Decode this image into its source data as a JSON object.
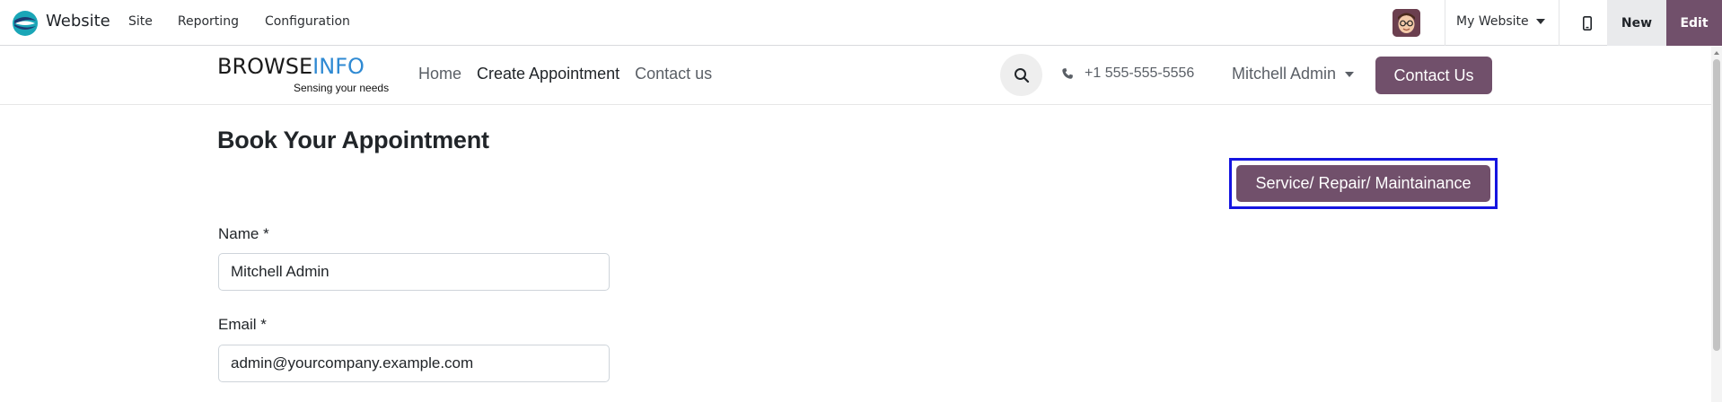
{
  "topbar": {
    "app_name": "Website",
    "menu": [
      "Site",
      "Reporting",
      "Configuration"
    ],
    "website_selector": "My Website",
    "new_label": "New",
    "edit_label": "Edit"
  },
  "site_header": {
    "brand": {
      "part1": "BROWSE",
      "part2": "INFO",
      "tagline": "Sensing your needs"
    },
    "nav": [
      {
        "label": "Home",
        "active": false
      },
      {
        "label": "Create Appointment",
        "active": true
      },
      {
        "label": "Contact us",
        "active": false
      }
    ],
    "phone": "+1 555-555-5556",
    "user_name": "Mitchell Admin",
    "contact_button": "Contact Us"
  },
  "page": {
    "title": "Book Your Appointment",
    "service_button": "Service/ Repair/ Maintainance",
    "fields": [
      {
        "label": "Name *",
        "value": "Mitchell Admin"
      },
      {
        "label": "Email *",
        "value": "admin@yourcompany.example.com"
      }
    ]
  },
  "colors": {
    "primary": "#71506b",
    "highlight_border": "#1515e0",
    "brand_blue": "#2f8ad3"
  }
}
